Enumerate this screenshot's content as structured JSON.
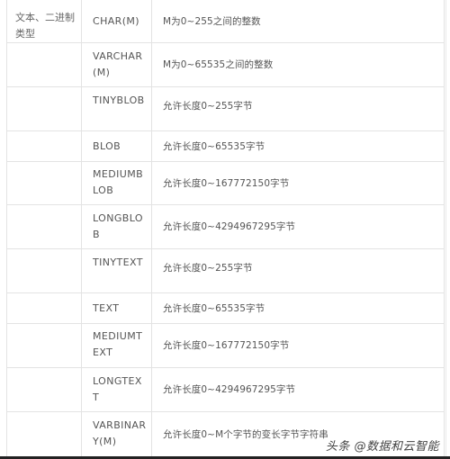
{
  "table": {
    "rows": [
      {
        "category": "文本、二进制类型",
        "type": "CHAR(M)",
        "description": "M为0~255之间的整数"
      },
      {
        "category": "",
        "type": "VARCHAR(M)",
        "description": "M为0~65535之间的整数"
      },
      {
        "category": "",
        "type": "TINYBLOB",
        "description": "允许长度0~255字节"
      },
      {
        "category": "",
        "type": "BLOB",
        "description": "允许长度0~65535字节"
      },
      {
        "category": "",
        "type": "MEDIUMBLOB",
        "description": "允许长度0~167772150字节"
      },
      {
        "category": "",
        "type": "LONGBLOB",
        "description": "允许长度0~4294967295字节"
      },
      {
        "category": "",
        "type": "TINYTEXT",
        "description": "允许长度0~255字节"
      },
      {
        "category": "",
        "type": "TEXT",
        "description": "允许长度0~65535字节"
      },
      {
        "category": "",
        "type": "MEDIUMTEXT",
        "description": "允许长度0~167772150字节"
      },
      {
        "category": "",
        "type": "LONGTEXT",
        "description": "允许长度0~4294967295字节"
      },
      {
        "category": "",
        "type": "VARBINARY(M)",
        "description": "允许长度0~M个字节的变长字节字符串"
      }
    ]
  },
  "watermark": "头条 @数据和云智能"
}
